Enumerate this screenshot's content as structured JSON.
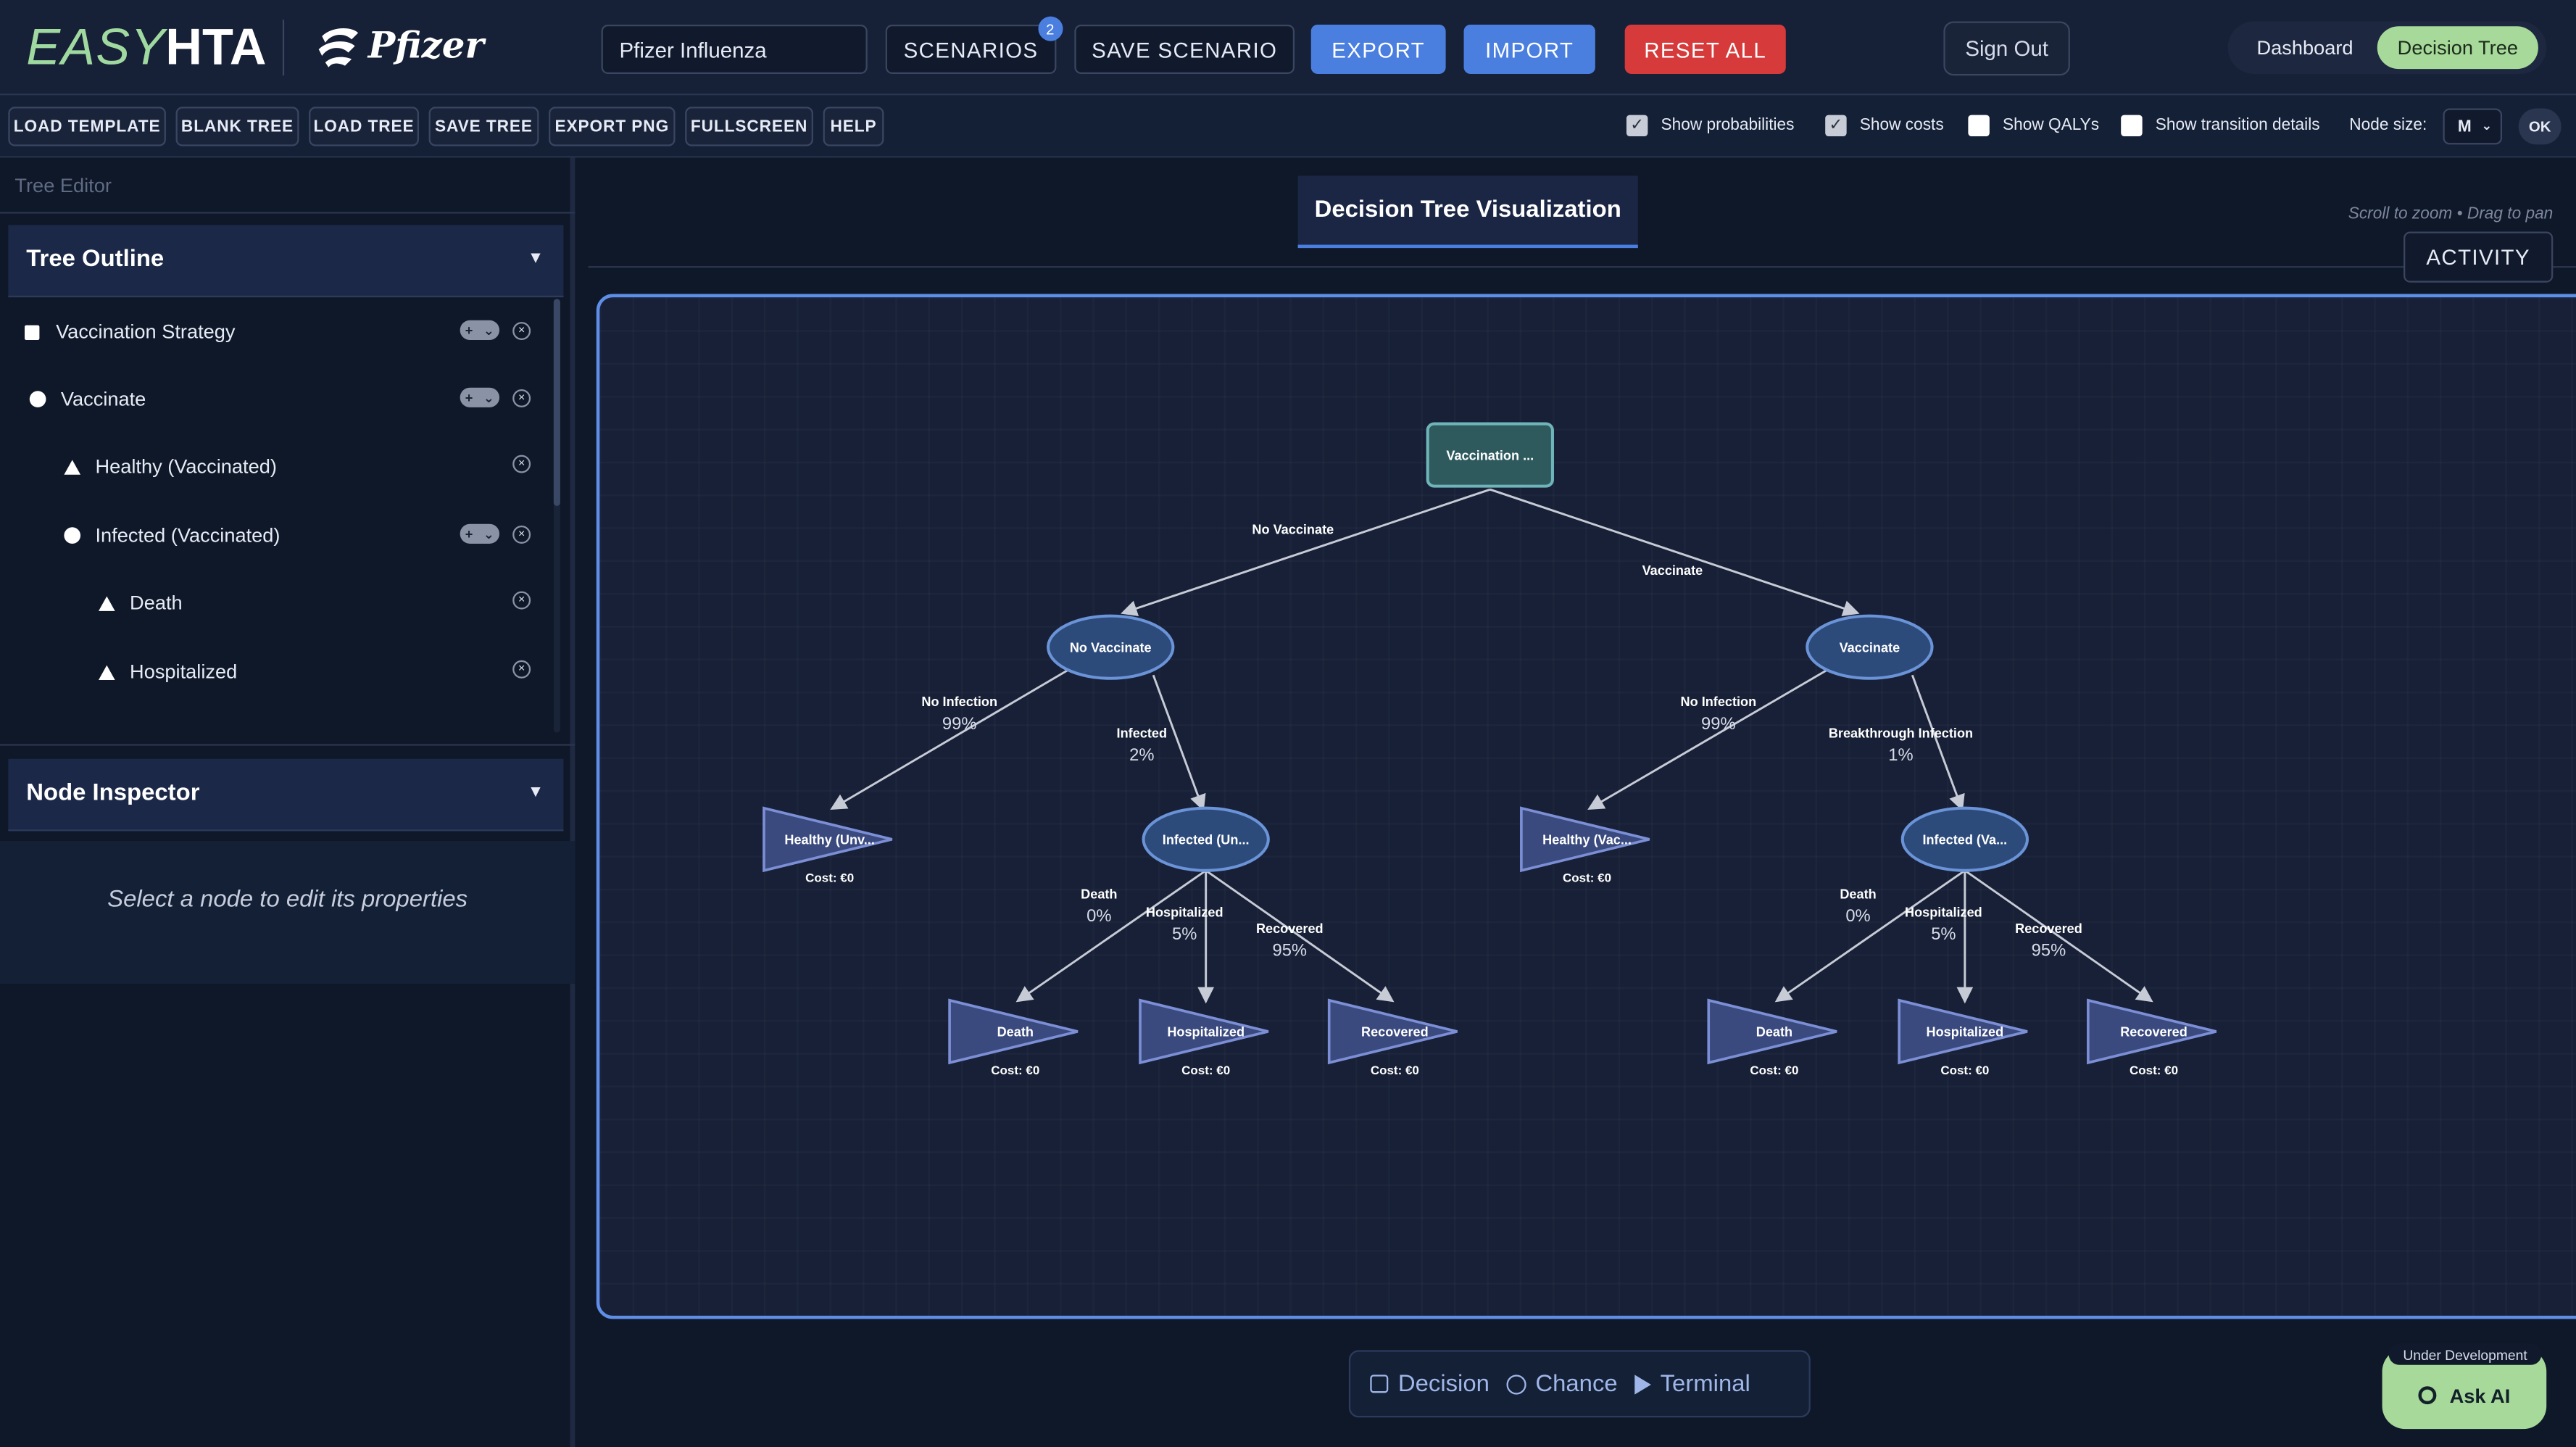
{
  "app": {
    "logo_easy": "EASY",
    "logo_hta": "HTA",
    "sponsor": "Pfizer"
  },
  "header": {
    "scenario_name": "Pfizer Influenza",
    "scenarios_label": "SCENARIOS",
    "scenarios_count": "2",
    "save_scenario_label": "SAVE SCENARIO",
    "export_label": "EXPORT",
    "import_label": "IMPORT",
    "reset_all_label": "RESET ALL",
    "sign_out_label": "Sign Out",
    "view_dashboard": "Dashboard",
    "view_decision_tree": "Decision Tree",
    "active_view": "Decision Tree"
  },
  "toolbar": {
    "buttons": [
      "LOAD TEMPLATE",
      "BLANK TREE",
      "LOAD TREE",
      "SAVE TREE",
      "EXPORT PNG",
      "FULLSCREEN",
      "HELP"
    ],
    "show_probabilities": {
      "label": "Show probabilities",
      "checked": true
    },
    "show_costs": {
      "label": "Show costs",
      "checked": true
    },
    "show_qalys": {
      "label": "Show QALYs",
      "checked": false
    },
    "show_transition_details": {
      "label": "Show transition details",
      "checked": false
    },
    "node_size_label": "Node size:",
    "node_size_value": "M",
    "ok_label": "OK"
  },
  "left_panel": {
    "editor_label": "Tree Editor",
    "outline_title": "Tree Outline",
    "outline": [
      {
        "label": "Vaccination Strategy",
        "type": "decision",
        "depth": 0,
        "can_add": true
      },
      {
        "label": "Vaccinate",
        "type": "chance",
        "depth": 0,
        "can_add": true
      },
      {
        "label": "Healthy (Vaccinated)",
        "type": "terminal",
        "depth": 1,
        "can_add": false
      },
      {
        "label": "Infected (Vaccinated)",
        "type": "chance",
        "depth": 1,
        "can_add": true
      },
      {
        "label": "Death",
        "type": "terminal",
        "depth": 2,
        "can_add": false
      },
      {
        "label": "Hospitalized",
        "type": "terminal",
        "depth": 2,
        "can_add": false
      }
    ],
    "inspector_title": "Node Inspector",
    "inspector_message": "Select a node to edit its properties"
  },
  "main": {
    "tab_title": "Decision Tree Visualization",
    "hint": "Scroll to zoom • Drag to pan",
    "activity_label": "ACTIVITY",
    "legend": {
      "decision": "Decision",
      "chance": "Chance",
      "terminal": "Terminal"
    },
    "ask_ai_tag": "Under Development",
    "ask_ai_label": "Ask AI"
  },
  "tree": {
    "root": {
      "label": "Vaccination ..."
    },
    "branches": [
      {
        "edge_label": "No Vaccinate",
        "node_label": "No Vaccinate",
        "children": [
          {
            "edge_label": "No Infection",
            "prob": "99%",
            "node_label": "Healthy (Unv...",
            "cost": "Cost: €0"
          },
          {
            "edge_label": "Infected",
            "prob": "2%",
            "node_label": "Infected (Un...",
            "children": [
              {
                "edge_label": "Death",
                "prob": "0%",
                "node_label": "Death",
                "cost": "Cost: €0"
              },
              {
                "edge_label": "Hospitalized",
                "prob": "5%",
                "node_label": "Hospitalized",
                "cost": "Cost: €0"
              },
              {
                "edge_label": "Recovered",
                "prob": "95%",
                "node_label": "Recovered",
                "cost": "Cost: €0"
              }
            ]
          }
        ]
      },
      {
        "edge_label": "Vaccinate",
        "node_label": "Vaccinate",
        "children": [
          {
            "edge_label": "No Infection",
            "prob": "99%",
            "node_label": "Healthy (Vac...",
            "cost": "Cost: €0"
          },
          {
            "edge_label": "Breakthrough Infection",
            "prob": "1%",
            "node_label": "Infected (Va...",
            "children": [
              {
                "edge_label": "Death",
                "prob": "0%",
                "node_label": "Death",
                "cost": "Cost: €0"
              },
              {
                "edge_label": "Hospitalized",
                "prob": "5%",
                "node_label": "Hospitalized",
                "cost": "Cost: €0"
              },
              {
                "edge_label": "Recovered",
                "prob": "95%",
                "node_label": "Recovered",
                "cost": "Cost: €0"
              }
            ]
          }
        ]
      }
    ]
  },
  "colors": {
    "accent_blue": "#4a7fe0",
    "danger_red": "#d63a3a",
    "brand_green": "#a7d99a",
    "decision_node": "#2e5a5e",
    "chance_node": "#2c4a7a",
    "terminal_node": "#3a4a7e"
  }
}
